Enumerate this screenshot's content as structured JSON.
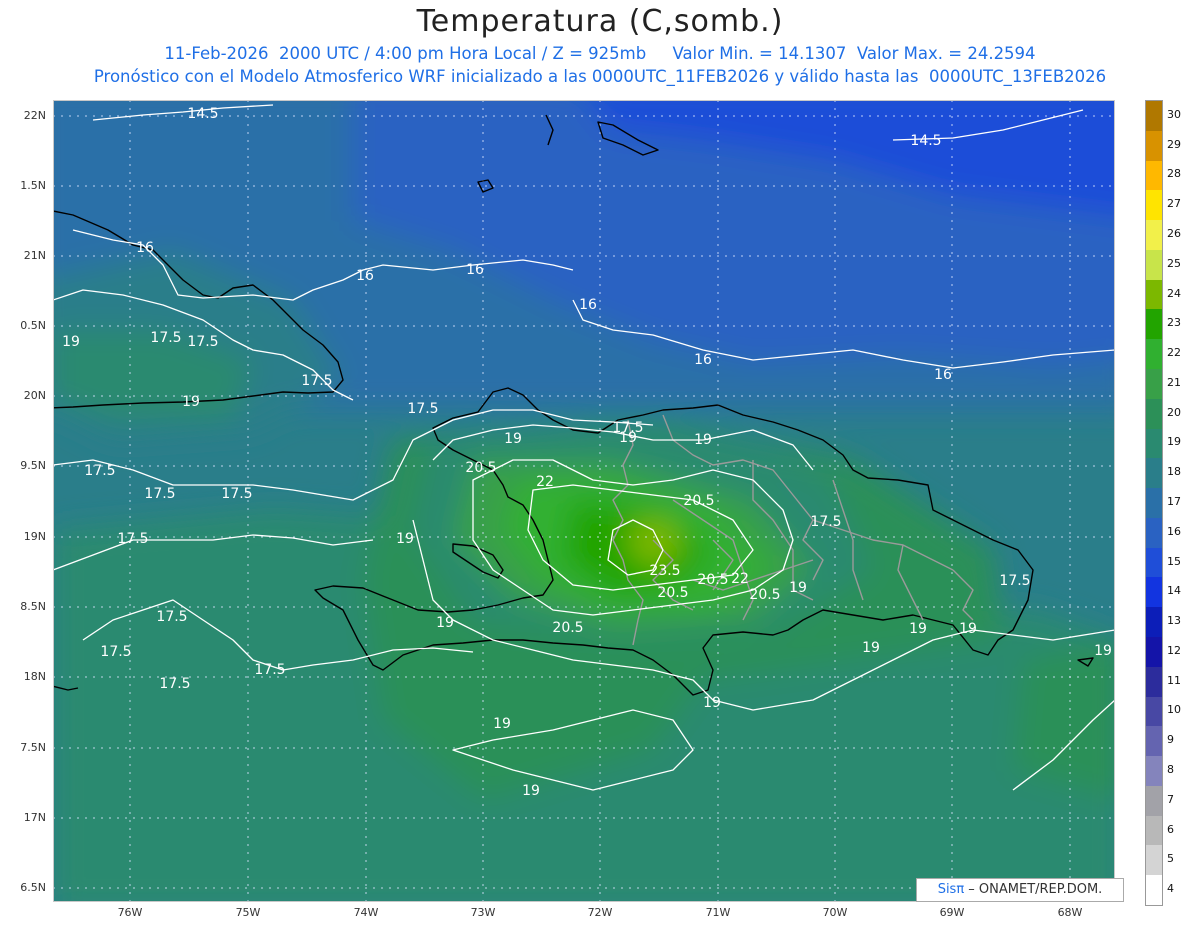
{
  "header": {
    "title": "Temperatura (C,somb.)",
    "line1": "11-Feb-2026  2000 UTC / 4:00 pm Hora Local / Z = 925mb     Valor Min. = 14.1307  Valor Max. = 24.2594",
    "line2": "Pronóstico con el Modelo Atmosferico WRF inicializado a las 0000UTC_11FEB2026 y válido hasta las  0000UTC_13FEB2026"
  },
  "axes": {
    "lat_labels": [
      "22N",
      "1.5N",
      "21N",
      "0.5N",
      "20N",
      "9.5N",
      "19N",
      "8.5N",
      "18N",
      "7.5N",
      "17N",
      "6.5N"
    ],
    "lon_labels": [
      "76W",
      "75W",
      "74W",
      "73W",
      "72W",
      "71W",
      "70W",
      "69W",
      "68W"
    ]
  },
  "contour_labels": [
    "14.5",
    "14.5",
    "16",
    "16",
    "16",
    "16",
    "16",
    "16",
    "17.5",
    "17.5",
    "17.5",
    "17.5",
    "17.5",
    "17.5",
    "17.5",
    "17.5",
    "17.5",
    "17.5",
    "17.5",
    "17.5",
    "17.5",
    "17.5",
    "17.5",
    "19",
    "19",
    "19",
    "19",
    "19",
    "19",
    "19",
    "19",
    "19",
    "19",
    "19",
    "19",
    "19",
    "19",
    "19",
    "20.5",
    "20.5",
    "20.5",
    "20.5",
    "20.5",
    "20.5",
    "22",
    "22",
    "23.5"
  ],
  "legend": {
    "labels": [
      "30",
      "29",
      "28",
      "27",
      "26",
      "25",
      "24",
      "23",
      "22",
      "21",
      "20",
      "19",
      "18",
      "17",
      "16",
      "15",
      "14",
      "13",
      "12",
      "11",
      "10",
      "9",
      "8",
      "7",
      "6",
      "5",
      "4"
    ],
    "colors": [
      "#b07800",
      "#d89200",
      "#ffb800",
      "#ffe400",
      "#f2f04a",
      "#c8e44a",
      "#7cb800",
      "#22a400",
      "#30b030",
      "#38a048",
      "#2c9058",
      "#2a8a70",
      "#2a7e8a",
      "#2a70a8",
      "#2a62c2",
      "#1f4ed8",
      "#1234e0",
      "#0c1eb8",
      "#1414a8",
      "#2c2c9c",
      "#4848a4",
      "#6464b0",
      "#8484bc",
      "#a2a2a8",
      "#b8b8b8",
      "#d4d4d4",
      "#ffffff"
    ]
  },
  "credit": {
    "sis": "Sisπ",
    "org": " – ONAMET/REP.DOM."
  }
}
